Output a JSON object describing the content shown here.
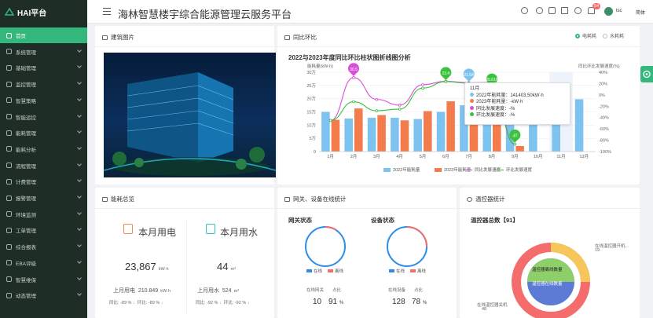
{
  "app": {
    "logo": "HAI平台",
    "title": "海林智慧楼宇综合能源管理云服务平台"
  },
  "header": {
    "notifications": "54",
    "user": "tsc",
    "language": "简体"
  },
  "sidebar": {
    "items": [
      "首页",
      "系统管理",
      "基础管理",
      "监控管理",
      "智慧策略",
      "智能运控",
      "能耗管理",
      "能耗分析",
      "流程管理",
      "计费管理",
      "报警管理",
      "环境监测",
      "工单管理",
      "综合报表",
      "EBA评级",
      "智慧维保",
      "动态管理"
    ]
  },
  "cards": {
    "building": "建筑图片",
    "compare": "同比环比",
    "energy_total": "能耗总览",
    "gateway": "网关、设备在线统计",
    "thermostat": "温控器统计"
  },
  "compare_toggle": {
    "options": [
      "电耗耗",
      "水耗耗"
    ],
    "selected": 0
  },
  "energy": {
    "elec": {
      "label": "本月用电",
      "value": "23,867",
      "unit": "kW·h",
      "last_label": "上月用电",
      "last_value": "210.849",
      "last_unit": "kW·h",
      "yoy": "同比: -89 %",
      "mom": "环比: -89 %"
    },
    "water": {
      "label": "本月用水",
      "value": "44",
      "unit": "m³",
      "last_label": "上月用水",
      "last_value": "524",
      "last_unit": "m³",
      "yoy": "同比: -92 %",
      "mom": "环比: -92 %"
    }
  },
  "gateway": {
    "title": "网关状态",
    "online": "在线",
    "offline": "离线",
    "online_label": "在线网关",
    "ratio_label": "占比",
    "count": "10",
    "ratio": "91",
    "pct": "%"
  },
  "device": {
    "title": "设备状态",
    "online": "在线",
    "offline": "离线",
    "online_label": "在线设备",
    "ratio_label": "占比",
    "count": "128",
    "ratio": "78",
    "pct": "%"
  },
  "thermostat": {
    "total": "温控器总数【91】",
    "inner_top": "温控器离线数量",
    "inner_bottom": "温控器在线数量",
    "label_right": "在线温控器开机...",
    "label_right_val": "19",
    "label_left": "在线温控器关机",
    "label_left_val": "48"
  },
  "tooltip": {
    "title": "11月",
    "r1": "2022年能耗量：141403.50kW·h",
    "r2": "2023年能耗量：-kW·h",
    "r3": "同比发展速度：-%",
    "r4": "环比发展速度：-%"
  },
  "colors": {
    "accent": "#34b77c",
    "bar2022": "#7ec3f0",
    "bar2023": "#f47c4c",
    "yoy": "#d94fd6",
    "mom": "#3bc23b"
  },
  "chart_data": {
    "type": "bar",
    "title": "2022与2023年度同比环比柱状图折线图分析",
    "ylabel": "能耗量(kW·h)",
    "y2label": "同比环比发展速度(%)",
    "categories": [
      "1月",
      "2月",
      "3月",
      "4月",
      "5月",
      "6月",
      "7月",
      "8月",
      "9月",
      "10月",
      "11月",
      "12月"
    ],
    "yticks": [
      "0",
      "5万",
      "10万",
      "15万",
      "20万",
      "25万",
      "30万"
    ],
    "y2ticks": [
      "40%",
      "20%",
      "0%",
      "-20%",
      "-40%",
      "-60%",
      "-80%",
      "-100%"
    ],
    "ylim": [
      0,
      300000
    ],
    "y2lim": [
      -100,
      40
    ],
    "series": [
      {
        "name": "2022年能耗量",
        "values": [
          150000,
          125000,
          128000,
          128000,
          123000,
          150000,
          175000,
          165000,
          138000,
          118000,
          141403,
          198000
        ]
      },
      {
        "name": "2023年能耗量",
        "values": [
          120000,
          163000,
          138000,
          118000,
          153000,
          190000,
          218000,
          196000,
          21000,
          null,
          null,
          null
        ]
      },
      {
        "name": "同比发展速度",
        "values": [
          -45,
          30.5,
          -8,
          -18,
          18,
          24,
          21.5,
          22,
          -87,
          null,
          null,
          null
        ]
      },
      {
        "name": "环比发展速度",
        "values": [
          -45,
          -12,
          -28,
          -25,
          12,
          23.4,
          20.6,
          12,
          -87,
          null,
          null,
          null
        ]
      }
    ],
    "point_labels": [
      {
        "i": 1,
        "text": "30.5"
      },
      {
        "i": 5,
        "text": "23.4"
      },
      {
        "i": 6,
        "text": "21.64"
      },
      {
        "i": 7,
        "text": "20.616"
      },
      {
        "i": 8,
        "text": "-87"
      }
    ],
    "legend": "bottom"
  }
}
